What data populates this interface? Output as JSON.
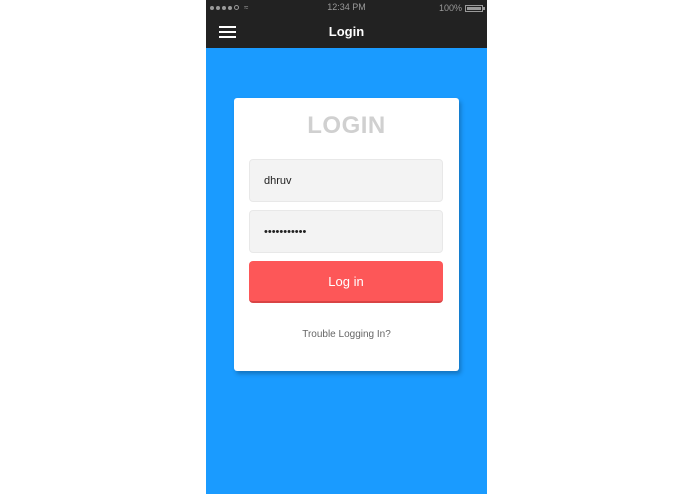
{
  "status_bar": {
    "time": "12:34 PM",
    "battery": "100%"
  },
  "nav": {
    "title": "Login",
    "menu_icon": "hamburger-menu-icon"
  },
  "login": {
    "heading": "LOGIN",
    "username_value": "dhruv",
    "password_value": "•••••••••••",
    "button_label": "Log in",
    "trouble_link": "Trouble Logging In?"
  },
  "colors": {
    "background": "#1a9bff",
    "nav": "#222222",
    "button": "#fd5758",
    "heading": "#d0d0d0"
  }
}
